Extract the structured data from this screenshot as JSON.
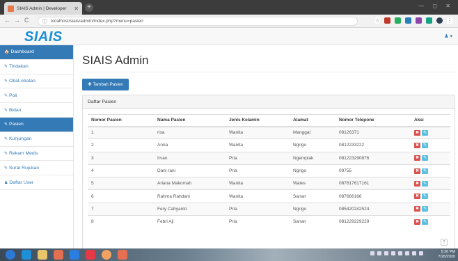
{
  "browser": {
    "tab_title": "SIAIS Admin | Developer",
    "tab_close": "✕",
    "new_tab": "+",
    "url": "localhost/siais/admin/index.php?menu=pasien"
  },
  "app": {
    "logo": "SIAIS",
    "user_menu": "♟ ▾"
  },
  "sidebar": {
    "items": [
      {
        "label": "Dashboard",
        "icon": "🏠",
        "active": false
      },
      {
        "label": "Tindakan",
        "icon": "✎",
        "active": false
      },
      {
        "label": "Obat-obatan",
        "icon": "✎",
        "active": false
      },
      {
        "label": "Poli",
        "icon": "✎",
        "active": false
      },
      {
        "label": "Bidan",
        "icon": "✎",
        "active": false
      },
      {
        "label": "Pasien",
        "icon": "✎",
        "active": true
      },
      {
        "label": "Kunjungan",
        "icon": "✎",
        "active": false
      },
      {
        "label": "Rekam Medis",
        "icon": "✎",
        "active": false
      },
      {
        "label": "Surat Rujukan",
        "icon": "✎",
        "active": false
      },
      {
        "label": "Daftar User",
        "icon": "♟",
        "active": false
      }
    ]
  },
  "main": {
    "title": "SIAIS Admin",
    "add_button": "Tambah Pasien",
    "panel_title": "Daftar Pasien",
    "columns": [
      "Nomor Pasien",
      "Nama Pasien",
      "Jenis Kelamin",
      "Alamat",
      "Nomor Telepone",
      "Aksi"
    ],
    "rows": [
      [
        "1",
        "risa",
        "Wanita",
        "Manggal",
        "08126371"
      ],
      [
        "2",
        "Anna",
        "Wanita",
        "Ngrigo",
        "0812233222"
      ],
      [
        "3",
        "Irvan",
        "Pria",
        "Ngemplak",
        "081223290876"
      ],
      [
        "4",
        "Dani rani",
        "Pria",
        "Ngrigo",
        "09755"
      ],
      [
        "5",
        "Ariana Makomah",
        "Wanita",
        "Wates",
        "087817617161"
      ],
      [
        "6",
        "Rahma Rahdani",
        "Wanita",
        "Sanan",
        "087666166"
      ],
      [
        "7",
        "Fery Cahyanto",
        "Pria",
        "Ngrigo",
        "085420242524"
      ],
      [
        "8",
        "Febri Aji",
        "Pria",
        "Sanan",
        "081229229229"
      ]
    ]
  },
  "taskbar": {
    "time": "5:20 PM",
    "date": "7/26/2020"
  },
  "colors": {
    "primary": "#337ab7",
    "danger": "#d9534f",
    "info": "#5bc0de",
    "logo": "#1a8fd8"
  }
}
